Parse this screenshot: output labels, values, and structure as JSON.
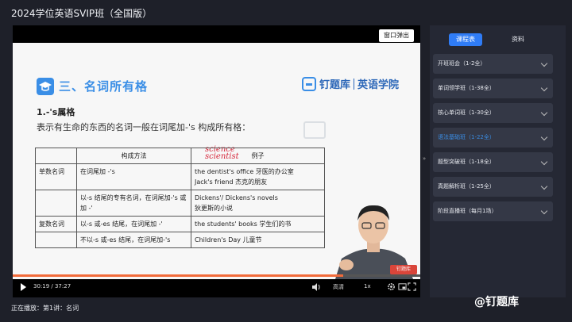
{
  "app": {
    "title": "2024学位英语SVIP班（全国版）"
  },
  "player": {
    "popout_label": "窗口弹出",
    "time": "30:19 / 37:27",
    "quality": "高清",
    "rate": "1x",
    "progress": 0.81,
    "colors": {
      "accent": "#3a8ee6",
      "progress": "#f26b3a"
    }
  },
  "slide": {
    "section_title": "三、名词所有格",
    "brand_name": "钉题库",
    "brand_sub": "英语学院",
    "sub_heading": "1.-'s属格",
    "description": "表示有生命的东西的名词一般在词尾加-'s 构成所有格：",
    "annotation_1": "science",
    "annotation_2": "scientist",
    "table": {
      "headers": [
        "构成方法",
        "例子"
      ],
      "rows": [
        {
          "cat": "单数名词",
          "method": "在词尾加 -'s",
          "example": "the dentist's office  牙医的办公室\nJack's friend  杰克的朋友"
        },
        {
          "cat": "",
          "method": "以-s 结尾的专有名词，在词尾加-'s 或加 -'",
          "example": "Dickens'/ Dickens's novels\n狄更斯的小说"
        },
        {
          "cat": "复数名词",
          "method": "以-s 或-es 结尾，在词尾加 -'",
          "example": "the students' books  学生们的书"
        },
        {
          "cat": "",
          "method": "不以-s 或-es 结尾，在词尾加-'s",
          "example": "Children's Day  儿童节"
        }
      ]
    },
    "badge": "钉题库"
  },
  "sidebar": {
    "tabs": {
      "schedule": "课程表",
      "materials": "资料"
    },
    "courses": [
      {
        "label": "开班班会（1-2全）"
      },
      {
        "label": "单词领学班（1-38全）"
      },
      {
        "label": "核心单词班（1-30全）"
      },
      {
        "label": "语法基础班（1-22全）"
      },
      {
        "label": "题型突破班（1-18全）"
      },
      {
        "label": "真题解析班（1-25全）"
      },
      {
        "label": "阶段直播班（每月1场）"
      }
    ]
  },
  "footer": {
    "now_playing": "正在播放：第1讲：名词"
  },
  "watermark": {
    "text": "@钉题库"
  }
}
